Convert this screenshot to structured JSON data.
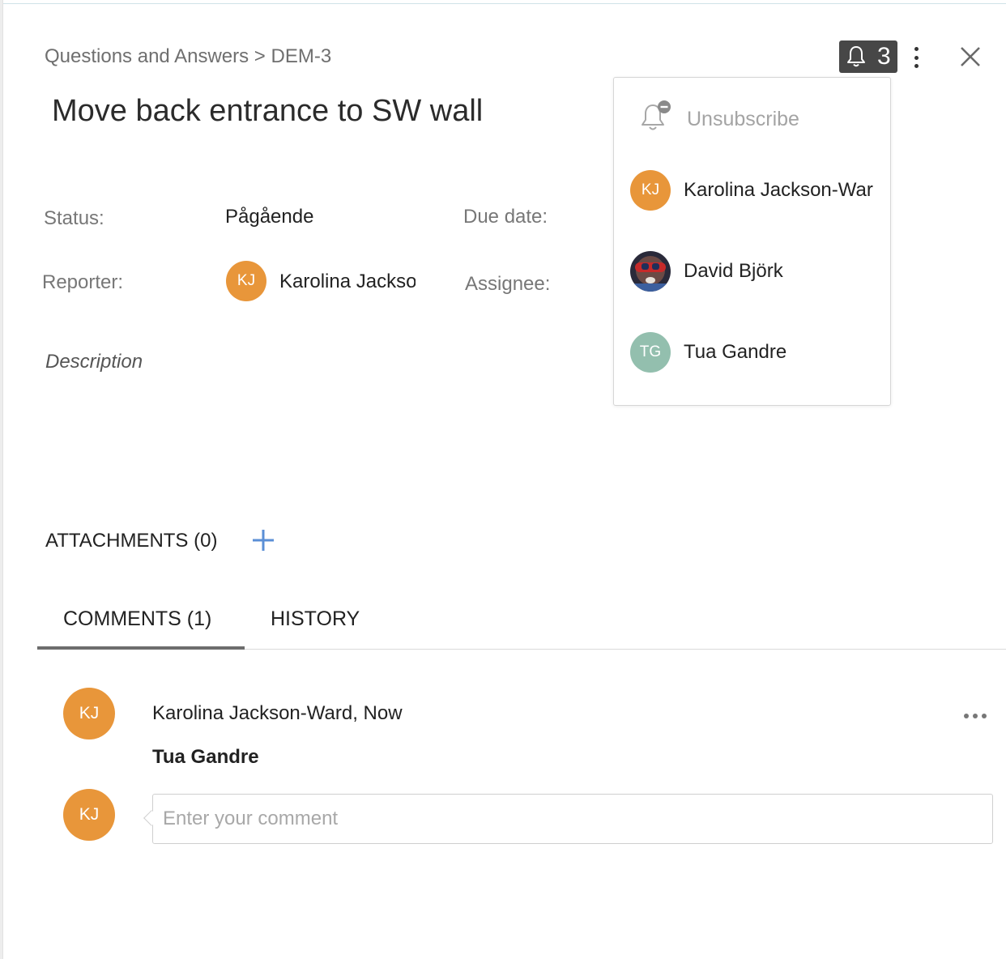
{
  "breadcrumb": "Questions and Answers > DEM-3",
  "title": "Move back entrance to SW wall",
  "header": {
    "subscriber_count": "3"
  },
  "fields": {
    "status_label": "Status:",
    "status_value": "Pågående",
    "due_label": "Due date:",
    "reporter_label": "Reporter:",
    "reporter_initials": "KJ",
    "reporter_name": "Karolina Jackson-Ward",
    "assignee_label": "Assignee:"
  },
  "description_label": "Description",
  "attachments_label": "ATTACHMENTS (0)",
  "tabs": [
    {
      "label": "COMMENTS (1)",
      "active": true
    },
    {
      "label": "HISTORY",
      "active": false
    }
  ],
  "comments": [
    {
      "initials": "KJ",
      "header": "Karolina Jackson-Ward, Now",
      "body": "Tua Gandre"
    }
  ],
  "comment_input": {
    "initials": "KJ",
    "placeholder": "Enter your comment"
  },
  "subscribers_popup": {
    "unsubscribe_label": "Unsubscribe",
    "subscribers": [
      {
        "initials": "KJ",
        "name": "Karolina Jackson-Ward",
        "color": "#e8963a"
      },
      {
        "initials": "",
        "name": "David Björk",
        "avatar": "photo"
      },
      {
        "initials": "TG",
        "name": "Tua Gandre",
        "color": "#93bfae"
      }
    ]
  },
  "colors": {
    "avatar_orange": "#e8963a",
    "avatar_green": "#93bfae",
    "bell_bg": "#474747",
    "accent_plus": "#5b8fd6"
  }
}
